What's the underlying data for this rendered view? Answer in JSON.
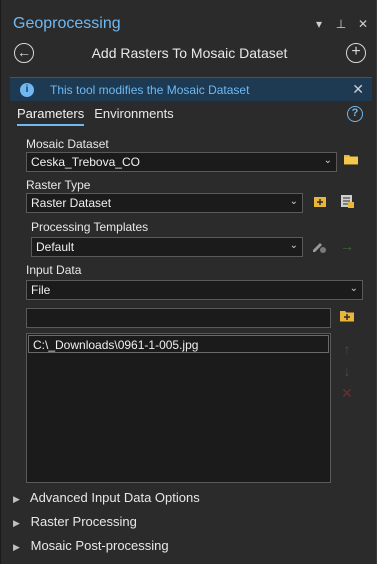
{
  "pane": {
    "title": "Geoprocessing",
    "controls": {
      "menu": "▾",
      "pin": "⊥",
      "close": "✕"
    }
  },
  "tool": {
    "title": "Add Rasters To Mosaic Dataset",
    "back_icon": "back-arrow-icon",
    "add_icon": "plus-icon"
  },
  "info": {
    "text": "This tool modifies the Mosaic Dataset",
    "icon": "i",
    "close": "✕"
  },
  "tabs": [
    {
      "label": "Parameters",
      "active": true
    },
    {
      "label": "Environments",
      "active": false
    }
  ],
  "help": "?",
  "params": {
    "mosaic_dataset": {
      "label": "Mosaic Dataset",
      "value": "Ceska_Trebova_CO"
    },
    "raster_type": {
      "label": "Raster Type",
      "value": "Raster Dataset"
    },
    "processing_templates": {
      "label": "Processing Templates",
      "value": "Default"
    },
    "input_data": {
      "label": "Input Data",
      "value": "File"
    },
    "input_path": {
      "value": ""
    },
    "input_list": [
      "C:\\_Downloads\\0961-1-005.jpg"
    ]
  },
  "sections": [
    {
      "label": "Advanced Input Data Options"
    },
    {
      "label": "Raster Processing"
    },
    {
      "label": "Mosaic Post-processing"
    }
  ],
  "glyphs": {
    "chevron": "⌄",
    "section_arrow": "▶",
    "up": "↑",
    "down": "↓",
    "remove": "✕",
    "run": "→"
  },
  "colors": {
    "accent": "#6fb8f2",
    "background": "#2b2b2b",
    "info_bg": "#1e3a52",
    "folder": "#e8b739"
  }
}
